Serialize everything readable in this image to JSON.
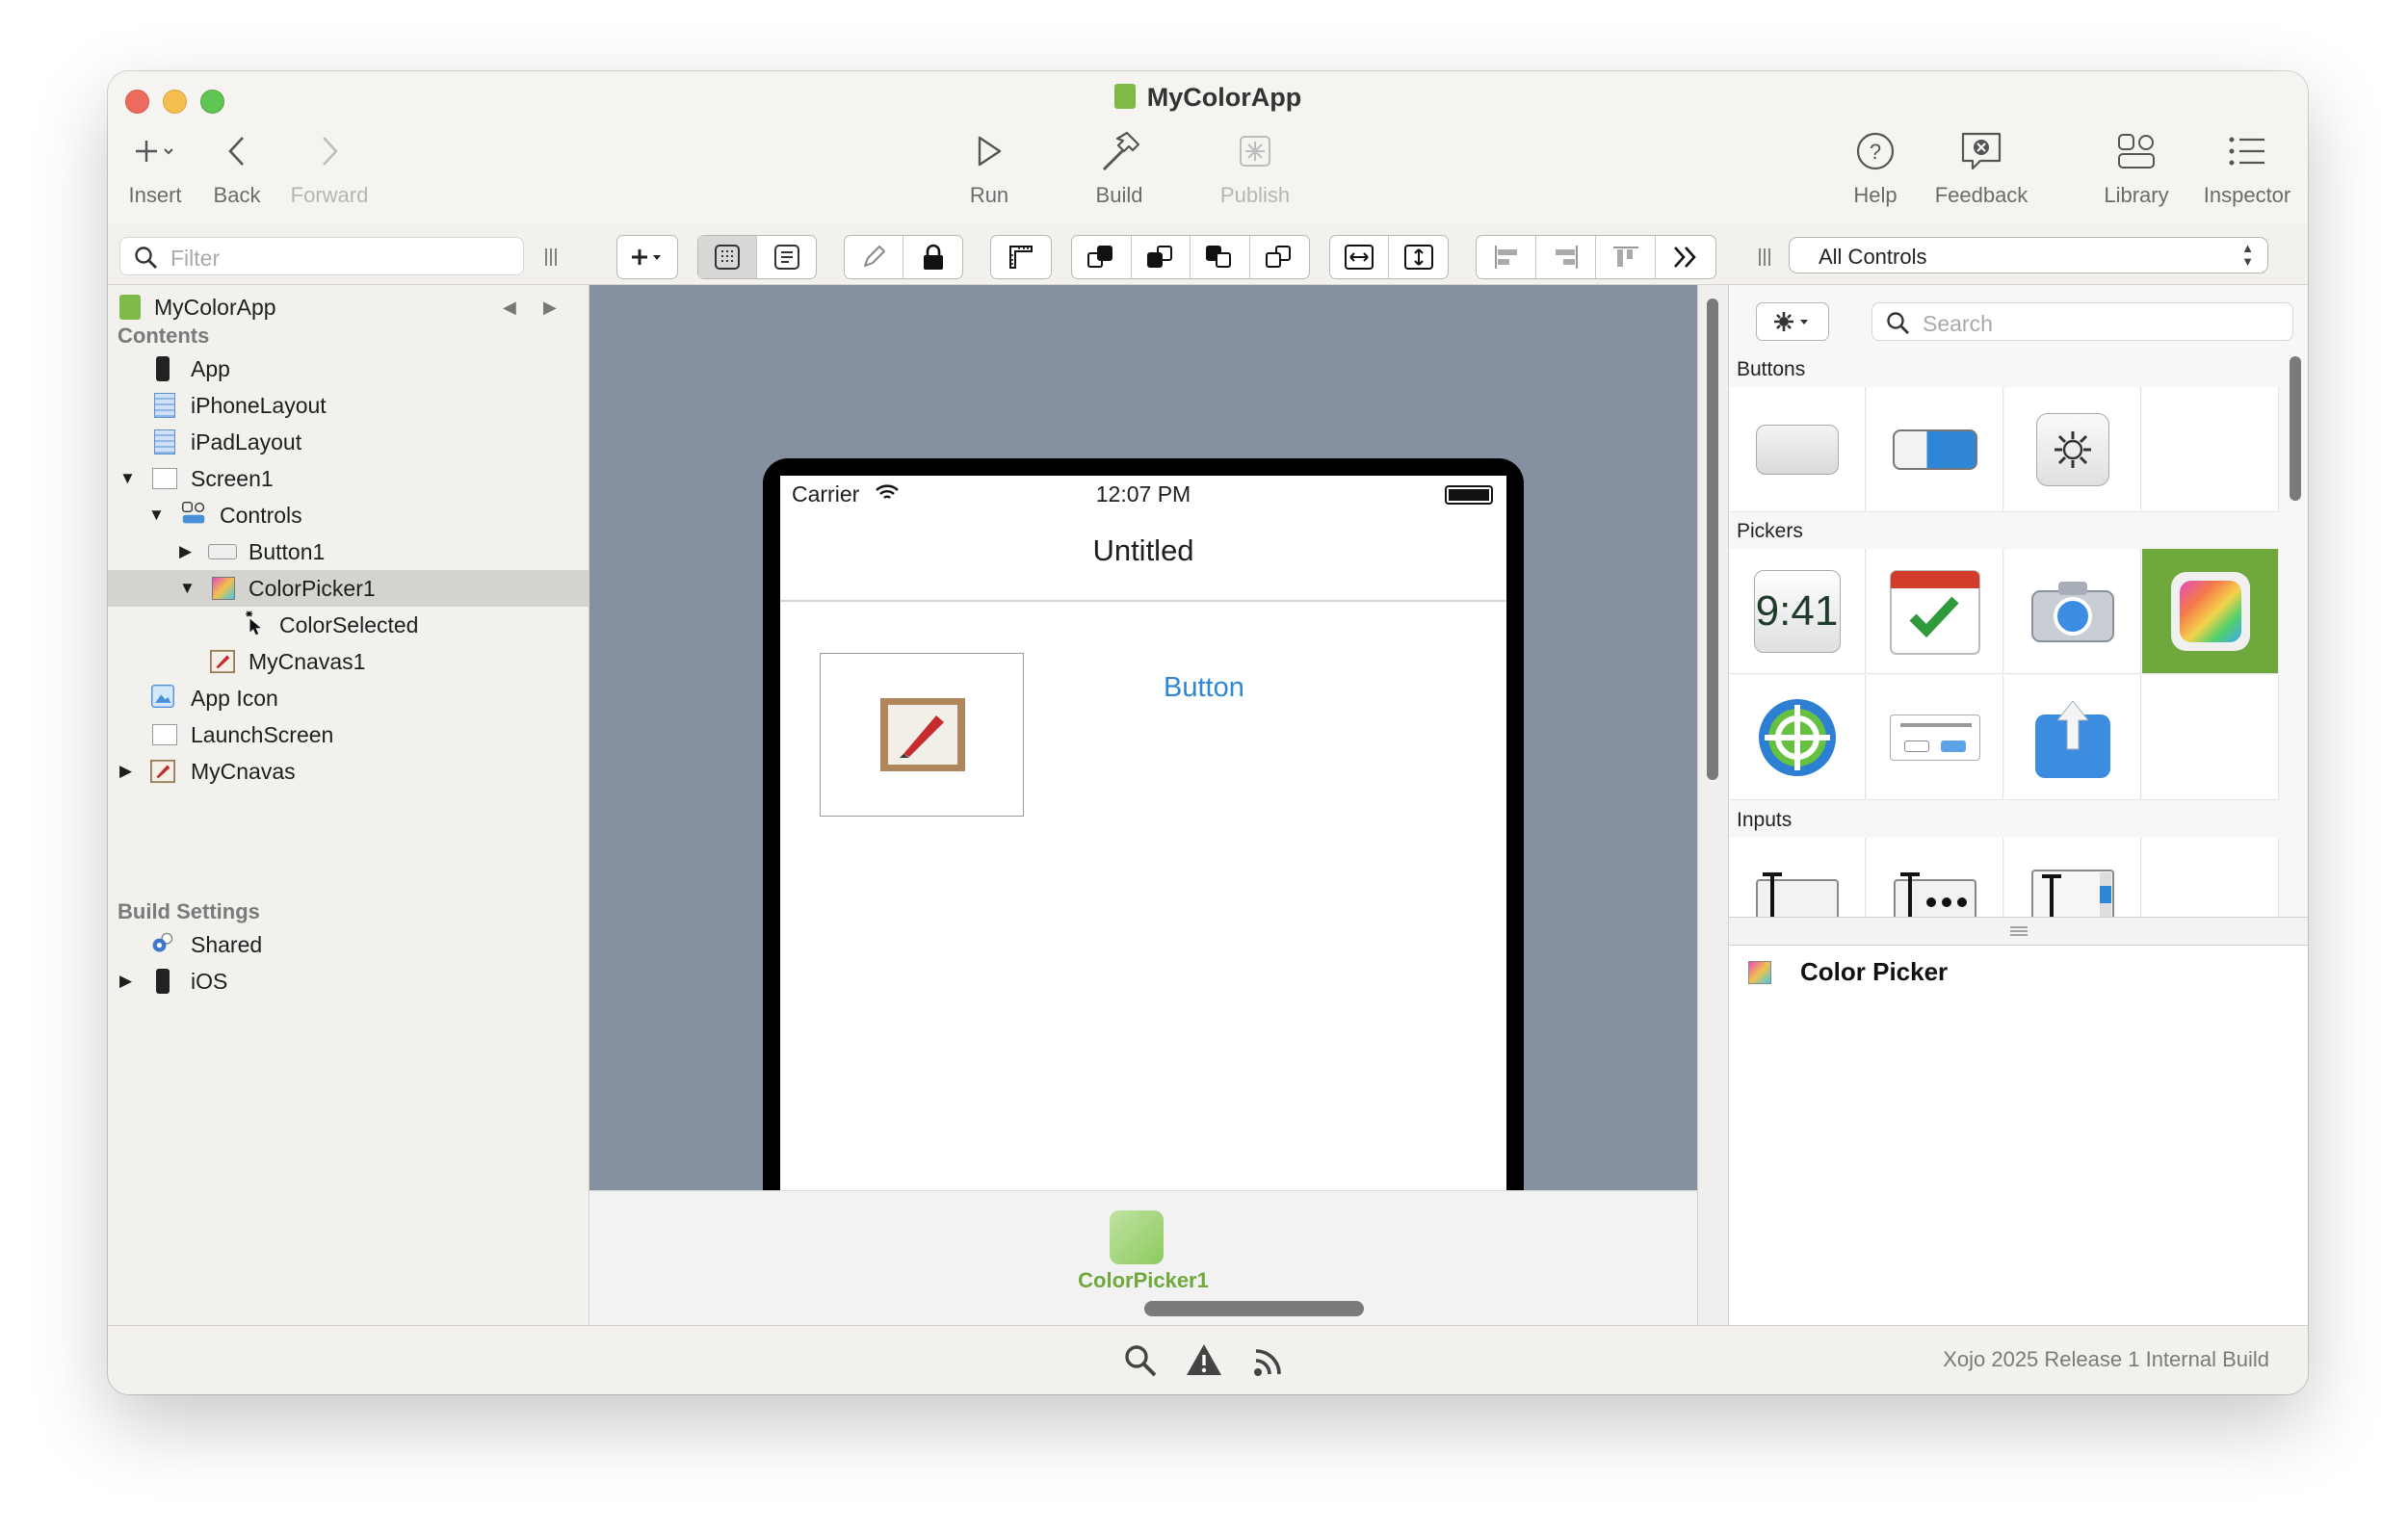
{
  "window": {
    "title": "MyColorApp"
  },
  "toolbar": {
    "insert": "Insert",
    "back": "Back",
    "forward": "Forward",
    "run": "Run",
    "build": "Build",
    "publish": "Publish",
    "help": "Help",
    "feedback": "Feedback",
    "library": "Library",
    "inspector": "Inspector"
  },
  "navigator": {
    "filter_placeholder": "Filter",
    "project": "MyColorApp",
    "contents_header": "Contents",
    "items": [
      "App",
      "iPhoneLayout",
      "iPadLayout",
      "Screen1",
      "Controls",
      "Button1",
      "ColorPicker1",
      "ColorSelected",
      "MyCnavas1",
      "App Icon",
      "LaunchScreen",
      "MyCnavas"
    ],
    "build_header": "Build Settings",
    "build_items": [
      "Shared",
      "iOS"
    ]
  },
  "layout_editor": {
    "carrier": "Carrier",
    "time": "12:07 PM",
    "nav_title": "Untitled",
    "button_label": "Button",
    "tray_item": "ColorPicker1"
  },
  "library": {
    "filter_select": "All Controls",
    "search_placeholder": "Search",
    "sections": [
      "Buttons",
      "Pickers",
      "Inputs"
    ],
    "time_icon_text": "9:41",
    "selected_control": "Color Picker"
  },
  "status": {
    "build_info": "Xojo 2025 Release 1 Internal Build"
  },
  "colors": {
    "accent_green": "#6fa83c",
    "link_blue": "#2f86d6",
    "canvas_bg": "#8591a0"
  }
}
